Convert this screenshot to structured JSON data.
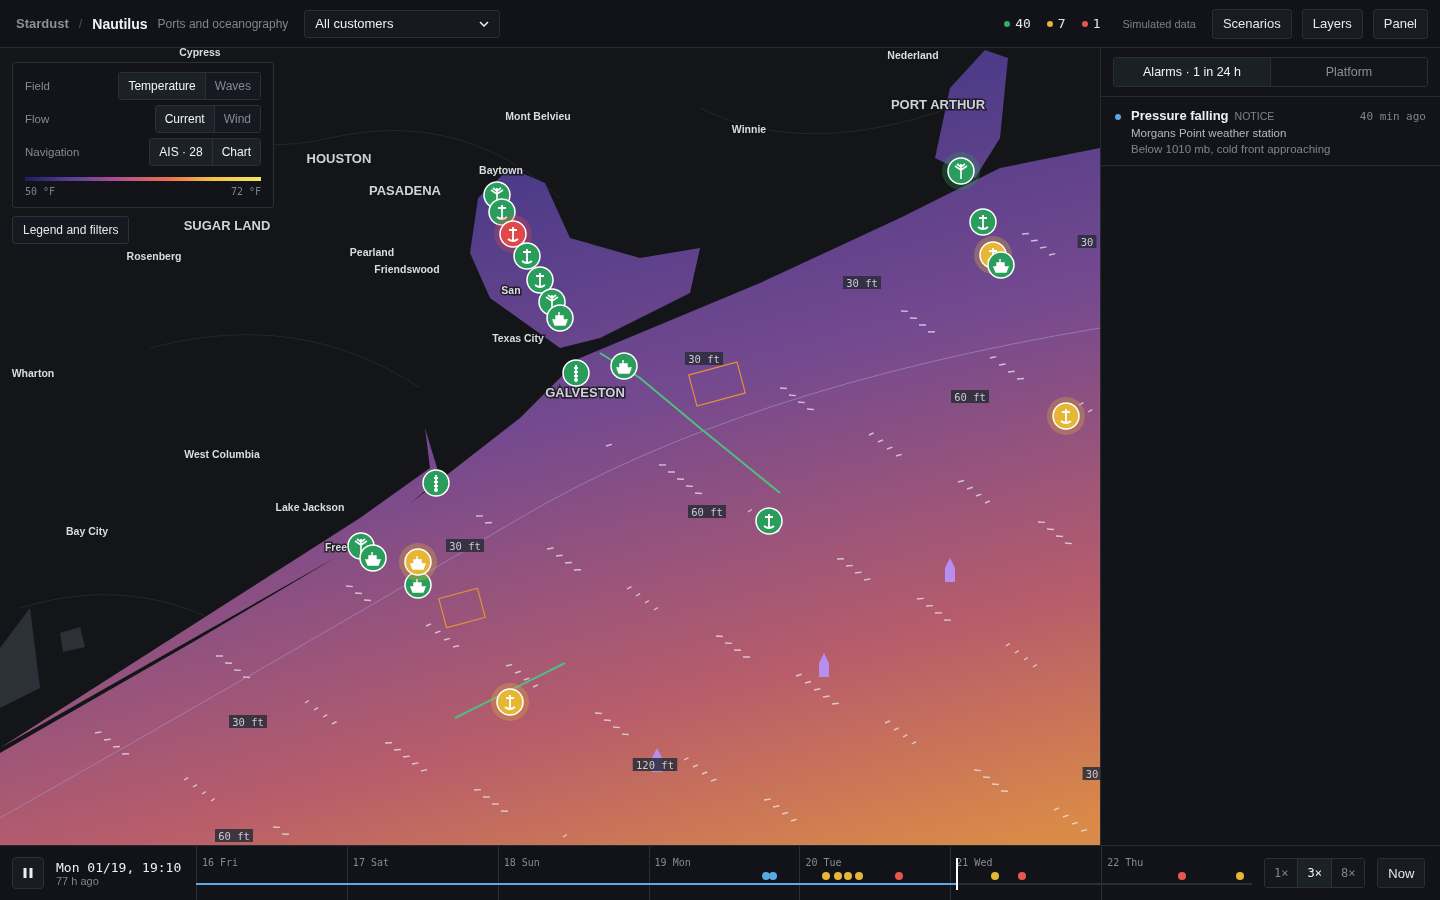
{
  "header": {
    "org": "Stardust",
    "separator": "/",
    "product": "Nautilus",
    "subtitle": "Ports and oceanography",
    "customer_select": {
      "value": "All customers"
    },
    "counts": [
      {
        "value": "40",
        "color": "#2fae6a"
      },
      {
        "value": "7",
        "color": "#e5b735"
      },
      {
        "value": "1",
        "color": "#e8574e"
      }
    ],
    "note": "Simulated data",
    "buttons": [
      "Scenarios",
      "Layers",
      "Panel"
    ]
  },
  "controls": {
    "rows": [
      {
        "label": "Field",
        "options": [
          {
            "label": "Temperature",
            "selected": true
          },
          {
            "label": "Waves",
            "selected": false
          }
        ]
      },
      {
        "label": "Flow",
        "options": [
          {
            "label": "Current",
            "selected": true
          },
          {
            "label": "Wind",
            "selected": false
          }
        ]
      },
      {
        "label": "Navigation",
        "options": [
          {
            "label": "AIS · 28",
            "selected": true
          },
          {
            "label": "Chart",
            "selected": true
          }
        ]
      }
    ],
    "scale_min": "50 °F",
    "scale_max": "72 °F",
    "legend_button": "Legend and filters"
  },
  "map": {
    "places": [
      {
        "name": "Cypress",
        "kind": "town"
      },
      {
        "name": "Nederland",
        "kind": "town"
      },
      {
        "name": "PORT ARTHUR",
        "kind": "city"
      },
      {
        "name": "Mont Belvieu",
        "kind": "town"
      },
      {
        "name": "Winnie",
        "kind": "town"
      },
      {
        "name": "HOUSTON",
        "kind": "city"
      },
      {
        "name": "Baytown",
        "kind": "town"
      },
      {
        "name": "PASADENA",
        "kind": "city"
      },
      {
        "name": "SUGAR LAND",
        "kind": "city"
      },
      {
        "name": "Rosenberg",
        "kind": "town"
      },
      {
        "name": "Pearland",
        "kind": "town"
      },
      {
        "name": "Friendswood",
        "kind": "town"
      },
      {
        "name": "San",
        "kind": "town"
      },
      {
        "name": "Texas City",
        "kind": "town"
      },
      {
        "name": "GALVESTON",
        "kind": "city"
      },
      {
        "name": "Wharton",
        "kind": "town"
      },
      {
        "name": "West Columbia",
        "kind": "town"
      },
      {
        "name": "Lake Jackson",
        "kind": "town"
      },
      {
        "name": "Bay City",
        "kind": "town"
      },
      {
        "name": "Free",
        "kind": "town"
      }
    ],
    "depths": [
      "30 ft",
      "30 ft",
      "60 ft",
      "60 ft",
      "30 ft",
      "30 ft",
      "120 ft",
      "60 ft",
      "30",
      "30"
    ],
    "markers": [
      {
        "kind": "weather",
        "color": "#2a9d5c",
        "highlighted": false
      },
      {
        "kind": "buoy",
        "color": "#2a9d5c",
        "highlighted": false
      },
      {
        "kind": "buoy",
        "color": "#e0484a",
        "highlighted": true
      },
      {
        "kind": "buoy",
        "color": "#2a9d5c",
        "highlighted": false
      },
      {
        "kind": "buoy",
        "color": "#2a9d5c",
        "highlighted": false
      },
      {
        "kind": "weather",
        "color": "#2a9d5c",
        "highlighted": false
      },
      {
        "kind": "vessel",
        "color": "#2a9d5c",
        "highlighted": false
      },
      {
        "kind": "gauge",
        "color": "#2a9d5c",
        "highlighted": false
      },
      {
        "kind": "vessel",
        "color": "#2a9d5c",
        "highlighted": false
      },
      {
        "kind": "weather",
        "color": "#2a9d5c",
        "highlighted": true
      },
      {
        "kind": "buoy",
        "color": "#2a9d5c",
        "highlighted": false
      },
      {
        "kind": "buoy",
        "color": "#e5b735",
        "highlighted": true
      },
      {
        "kind": "vessel",
        "color": "#2a9d5c",
        "highlighted": false
      },
      {
        "kind": "buoy",
        "color": "#e5b735",
        "highlighted": true
      },
      {
        "kind": "gauge",
        "color": "#2a9d5c",
        "highlighted": false
      },
      {
        "kind": "buoy",
        "color": "#2a9d5c",
        "highlighted": false
      },
      {
        "kind": "weather",
        "color": "#2a9d5c",
        "highlighted": false
      },
      {
        "kind": "vessel",
        "color": "#2a9d5c",
        "highlighted": false
      },
      {
        "kind": "vessel",
        "color": "#2a9d5c",
        "highlighted": false
      },
      {
        "kind": "vessel",
        "color": "#e5b735",
        "highlighted": true
      },
      {
        "kind": "buoy",
        "color": "#e5b735",
        "highlighted": true
      }
    ]
  },
  "panel": {
    "tabs": [
      {
        "label": "Alarms · 1 in 24 h",
        "selected": true
      },
      {
        "label": "Platform",
        "selected": false
      }
    ],
    "alarms": [
      {
        "title": "Pressure falling",
        "severity": "NOTICE",
        "time": "40 min ago",
        "source": "Morgans Point weather station",
        "detail": "Below 1010 mb, cold front approaching",
        "color": "#5aa9e6"
      }
    ]
  },
  "timeline": {
    "time": "Mon 01/19, 19:10",
    "ago": "77 h ago",
    "days": [
      "16 Fri",
      "17 Sat",
      "18 Sun",
      "19 Mon",
      "20 Tue",
      "21 Wed",
      "22 Thu"
    ],
    "level": 0.72,
    "events": [
      {
        "color": "#5aa9e6"
      },
      {
        "color": "#5aa9e6"
      },
      {
        "color": "#e5b735"
      },
      {
        "color": "#e5b735"
      },
      {
        "color": "#e5b735"
      },
      {
        "color": "#e5b735"
      },
      {
        "color": "#e8574e"
      },
      {
        "color": "#e5b735"
      },
      {
        "color": "#e8574e"
      },
      {
        "color": "#e8574e"
      },
      {
        "color": "#e5b735"
      }
    ],
    "speeds": [
      {
        "label": "1×",
        "selected": false
      },
      {
        "label": "3×",
        "selected": true
      },
      {
        "label": "8×",
        "selected": false
      }
    ],
    "now": "Now"
  }
}
